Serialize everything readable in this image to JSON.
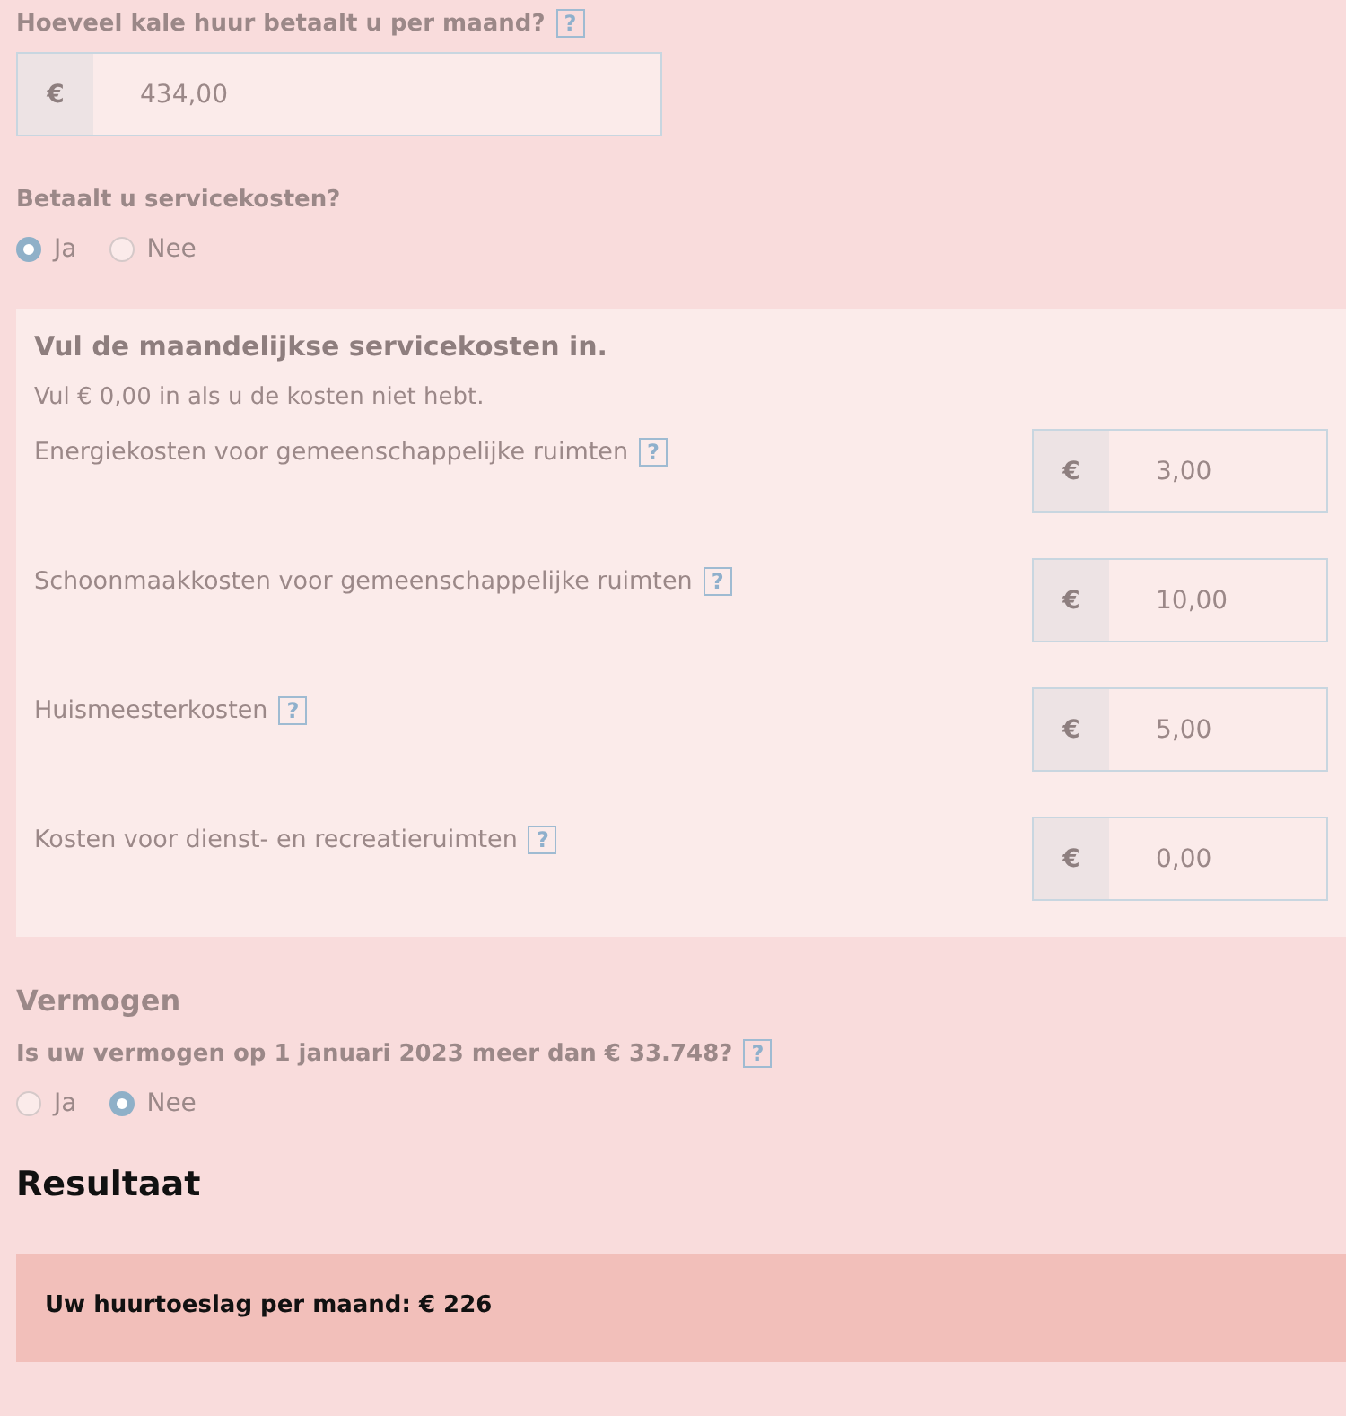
{
  "rent": {
    "label": "Hoeveel kale huur betaalt u per maand?",
    "help": "?",
    "prefix": "€",
    "value": "434,00"
  },
  "service_question": {
    "label": "Betaalt u servicekosten?",
    "options": [
      {
        "label": "Ja",
        "selected": true
      },
      {
        "label": "Nee",
        "selected": false
      }
    ]
  },
  "service_panel": {
    "title": "Vul de maandelijkse servicekosten in.",
    "hint": "Vul € 0,00 in als u de kosten niet hebt.",
    "rows": [
      {
        "label": "Energiekosten voor gemeenschappelijke ruimten",
        "help": "?",
        "prefix": "€",
        "value": "3,00"
      },
      {
        "label": "Schoonmaakkosten voor gemeenschappelijke ruimten",
        "help": "?",
        "prefix": "€",
        "value": "10,00"
      },
      {
        "label": "Huismeesterkosten",
        "help": "?",
        "prefix": "€",
        "value": "5,00"
      },
      {
        "label": "Kosten voor dienst- en recreatieruimten",
        "help": "?",
        "prefix": "€",
        "value": "0,00"
      }
    ]
  },
  "assets": {
    "heading": "Vermogen",
    "label": "Is uw vermogen op 1 januari 2023 meer dan € 33.748?",
    "help": "?",
    "options": [
      {
        "label": "Ja",
        "selected": false
      },
      {
        "label": "Nee",
        "selected": true
      }
    ]
  },
  "result": {
    "heading": "Resultaat",
    "text": "Uw huurtoeslag per maand: € 226"
  }
}
